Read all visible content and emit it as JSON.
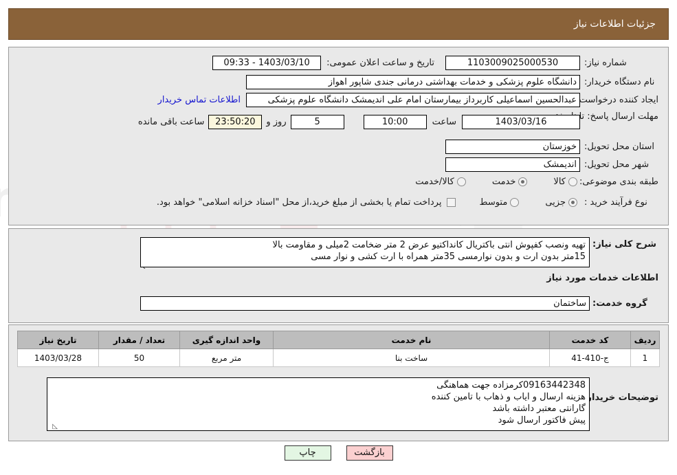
{
  "header": {
    "title": "جزئیات اطلاعات نیاز"
  },
  "info": {
    "need_number_label": "شماره نیاز:",
    "need_number_value": "1103009025000530",
    "announce_label": "تاریخ و ساعت اعلان عمومی:",
    "announce_value": "1403/03/10 - 09:33",
    "buyer_org_label": "نام دستگاه خریدار:",
    "buyer_org_value": "دانشگاه علوم پزشکی و خدمات بهداشتی درمانی جندی شاپور اهواز",
    "creator_label": "ایجاد کننده درخواست:",
    "creator_value": "عبدالحسین اسماعیلی کاربرداز بیمارستان امام علی اندیمشک دانشگاه علوم پزشکی",
    "contact_link": "اطلاعات تماس خریدار",
    "deadline_label": "مهلت ارسال پاسخ: تا تاریخ:",
    "deadline_date": "1403/03/16",
    "hour_label": "ساعت",
    "deadline_time": "10:00",
    "days_value": "5",
    "days_label": "روز و",
    "countdown_value": "23:50:20",
    "countdown_label": "ساعت باقی مانده",
    "province_label": "استان محل تحویل:",
    "province_value": "خوزستان",
    "city_label": "شهر محل تحویل:",
    "city_value": "اندیمشک",
    "category_label": "طبقه بندی موضوعی:",
    "category_options": [
      "کالا",
      "خدمت",
      "کالا/خدمت"
    ],
    "category_selected": "خدمت",
    "process_label": "نوع فرآیند خرید :",
    "process_options": [
      "جزیی",
      "متوسط"
    ],
    "process_selected": "جزیی",
    "treasury_note": "پرداخت تمام یا بخشی از مبلغ خرید،از محل \"اسناد خزانه اسلامی\" خواهد بود."
  },
  "description": {
    "label": "شرح کلی نیاز:",
    "value": "تهیه ونصب کفپوش انتی باکتریال کانداکتیو عرض 2 متر ضخامت 2میلی و مقاومت بالا\n15متر بدون ارت و بدون نوارمسی 35متر همراه با ارت کشی و نوار مسی",
    "section_title": "اطلاعات خدمات مورد نیاز",
    "service_group_label": "گروه خدمت:",
    "service_group_value": "ساختمان"
  },
  "items_table": {
    "columns": [
      "ردیف",
      "کد خدمت",
      "نام خدمت",
      "واحد اندازه گیری",
      "تعداد / مقدار",
      "تاریخ نیاز"
    ],
    "rows": [
      {
        "row_no": "1",
        "service_code": "ج-410-41",
        "service_name": "ساخت بنا",
        "unit": "متر مربع",
        "quantity": "50",
        "need_date": "1403/03/28"
      }
    ]
  },
  "buyer_notes": {
    "label": "توضیحات خریدار:",
    "value": "09163442348کرمزاده جهت هماهنگی\nهزینه ارسال و ایاب و ذهاب با تامین کننده\nگارانتی معتبر داشته باشد\nپیش فاکتور ارسال شود"
  },
  "buttons": {
    "print": "چاپ",
    "back": "بازگشت"
  },
  "watermark": {
    "text": "AriaTender.net"
  },
  "colors": {
    "header_bg": "#8a6239",
    "panel_bg": "#e9e9e9",
    "link": "#1414cf",
    "back_btn": "#fbd0d0",
    "print_btn": "#e3f6e3",
    "table_header": "#bdbdbd"
  }
}
